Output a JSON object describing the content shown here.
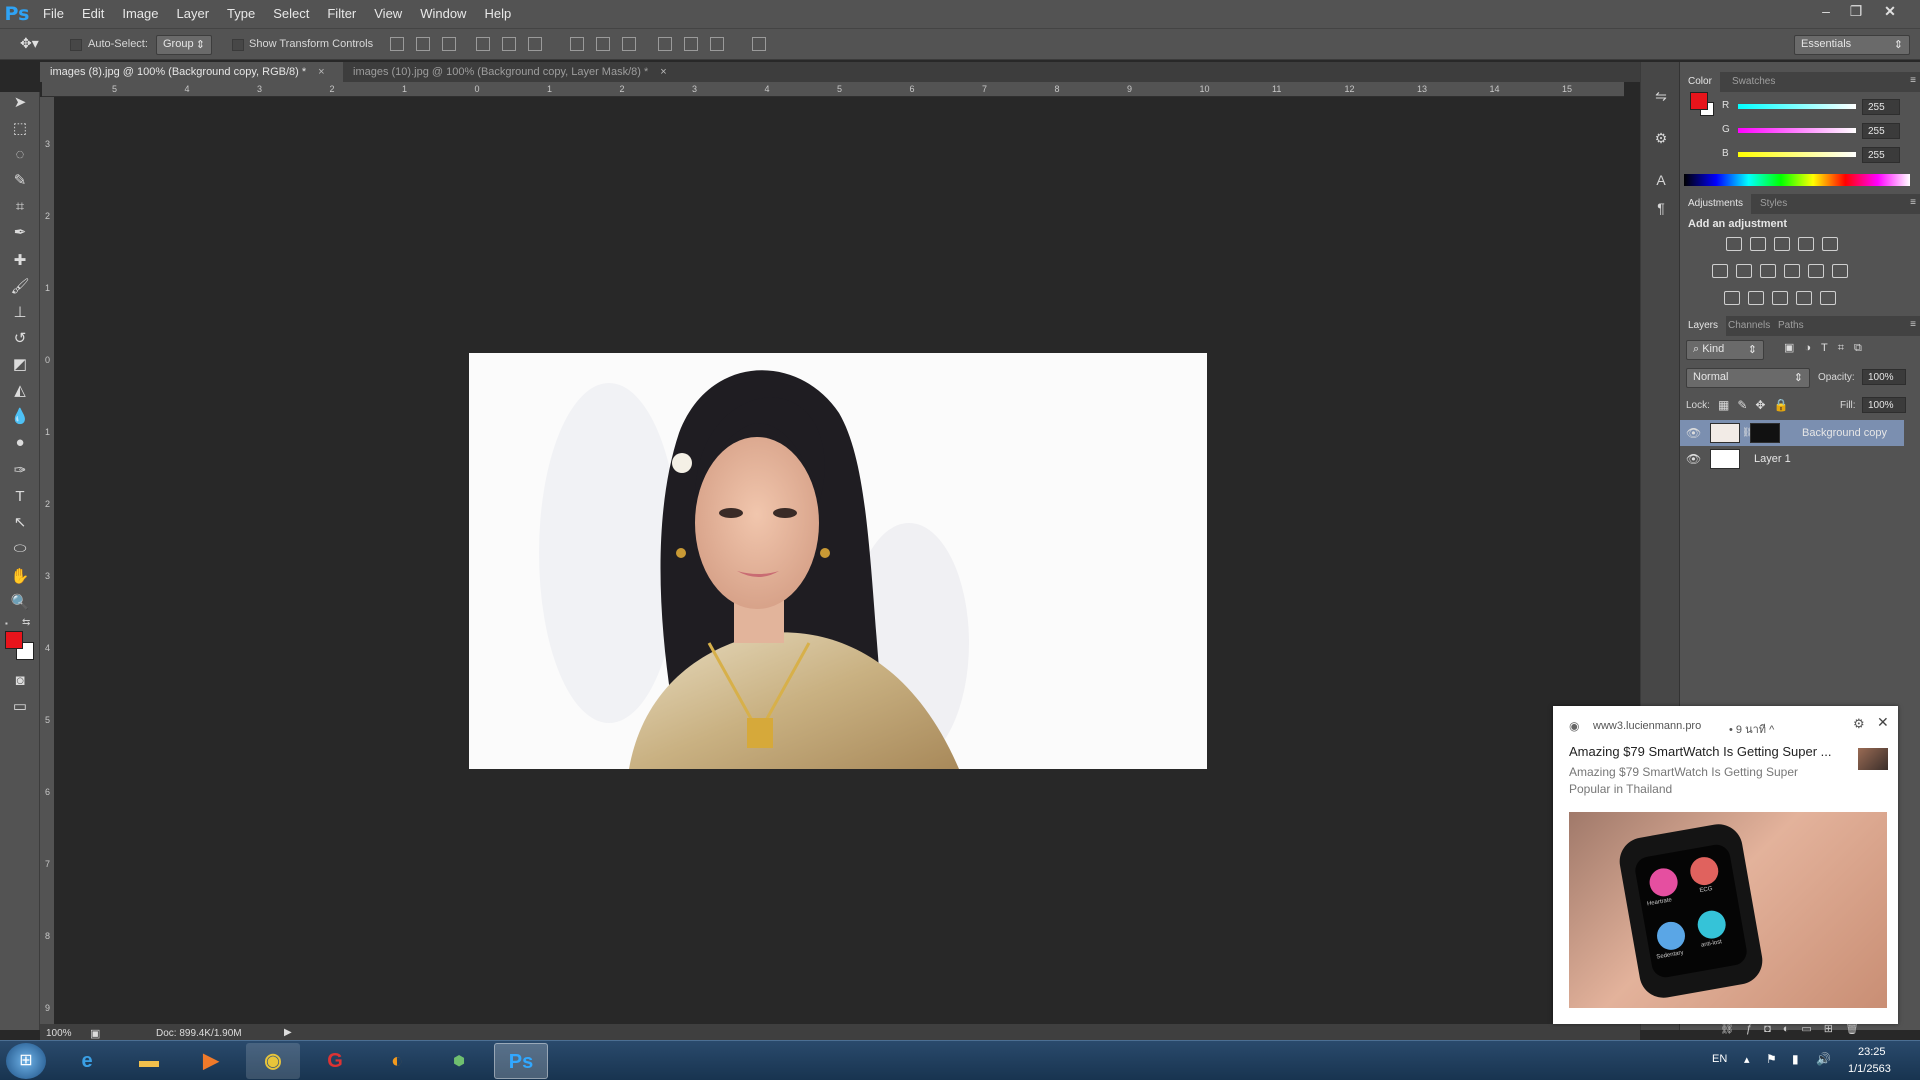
{
  "app": {
    "logo": "Ps"
  },
  "menu": [
    "File",
    "Edit",
    "Image",
    "Layer",
    "Type",
    "Select",
    "Filter",
    "View",
    "Window",
    "Help"
  ],
  "window_controls": {
    "minimize": "–",
    "restore": "❐",
    "close": "✕"
  },
  "options": {
    "auto_select_label": "Auto-Select:",
    "group_value": "Group",
    "transform_label": "Show Transform Controls",
    "workspace": "Essentials"
  },
  "tabs": [
    {
      "label": "images (8).jpg @ 100% (Background copy, RGB/8) *",
      "close": "×"
    },
    {
      "label": "images (10).jpg @ 100% (Background copy, Layer Mask/8) *",
      "close": "×"
    }
  ],
  "ruler_h": [
    "5",
    "4",
    "3",
    "2",
    "1",
    "0",
    "1",
    "2",
    "3",
    "4",
    "5",
    "6",
    "7",
    "8",
    "9",
    "10",
    "11",
    "12",
    "13",
    "14",
    "15"
  ],
  "ruler_v": [
    "3",
    "2",
    "1",
    "0",
    "1",
    "2",
    "3",
    "4",
    "5",
    "6",
    "7",
    "8",
    "9"
  ],
  "status": {
    "zoom": "100%",
    "doc": "Doc: 899.4K/1.90M"
  },
  "color_panel": {
    "tabs": [
      "Color",
      "Swatches"
    ],
    "r_label": "R",
    "g_label": "G",
    "b_label": "B",
    "r": "255",
    "g": "255",
    "b": "255",
    "foreground": "#e8141b",
    "background": "#ffffff"
  },
  "adjust_panel": {
    "tabs": [
      "Adjustments",
      "Styles"
    ],
    "heading": "Add an adjustment"
  },
  "layers_panel": {
    "tabs": [
      "Layers",
      "Channels",
      "Paths"
    ],
    "kind": "Kind",
    "blend": "Normal",
    "opacity_label": "Opacity:",
    "opacity": "100%",
    "lock_label": "Lock:",
    "fill_label": "Fill:",
    "fill": "100%",
    "layers": [
      {
        "name": "Background copy",
        "selected": true
      },
      {
        "name": "Layer 1",
        "selected": false
      }
    ]
  },
  "notification": {
    "source": "www3.lucienmann.pro",
    "time": "• 9 นาที ^",
    "title": "Amazing $79 SmartWatch Is Getting Super ...",
    "body": "Amazing $79 SmartWatch Is Getting Super Popular in Thailand",
    "watch_labels": [
      "Heartrate",
      "ECG",
      "Sedentary",
      "anti-lost"
    ]
  },
  "taskbar": {
    "lang": "EN",
    "time": "23:25",
    "date": "1/1/2563"
  }
}
